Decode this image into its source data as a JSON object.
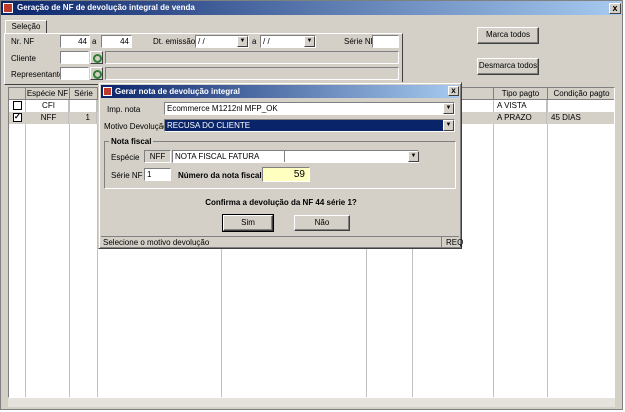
{
  "window": {
    "title": "Geração de NF de devolução integral de venda",
    "close": "x"
  },
  "tab": {
    "label": "Seleção"
  },
  "filters": {
    "nr_nf_label": "Nr. NF",
    "nr_nf_from": "44",
    "sep_a": "a",
    "nr_nf_to": "44",
    "dt_emissao_label": "Dt. emissão",
    "dt_from": " /  / ",
    "dt_to": " /  / ",
    "serie_nf_label": "Série NF",
    "cliente_label": "Cliente",
    "representante_label": "Representante"
  },
  "buttons": {
    "marca_todos": "Marca todos",
    "desmarca_todos": "Desmarca todos"
  },
  "grid": {
    "headers": [
      "Espécie NF",
      "Série",
      "Tipo pagto",
      "Condição pagto"
    ],
    "rows": [
      {
        "checked": false,
        "especie": "CFI",
        "serie": "",
        "tipo_pagto": "A VISTA",
        "condicao": ""
      },
      {
        "checked": true,
        "especie": "NFF",
        "serie": "1",
        "tipo_pagto": "A PRAZO",
        "condicao": "45 DIAS"
      }
    ]
  },
  "dialog": {
    "title": "Gerar nota de devolução integral",
    "close": "x",
    "imp_nota_label": "Imp. nota",
    "imp_nota_value": "Ecommerce M1212nl MFP_OK",
    "motivo_label": "Motivo Devolução",
    "motivo_value": "RECUSA DO CLIENTE",
    "group_title": "Nota fiscal",
    "especie_label": "Espécie",
    "especie_code": "NFF",
    "especie_value": "NOTA FISCAL FATURA",
    "serie_label": "Série NF",
    "serie_value": "1",
    "numero_label": "Número da nota fiscal",
    "numero_value": "59",
    "confirm_text": "Confirma a devolução da NF 44  série 1?",
    "sim": "Sim",
    "nao": "Não",
    "status_text": "Selecione o motivo devolução",
    "status_mode": "REQ"
  }
}
